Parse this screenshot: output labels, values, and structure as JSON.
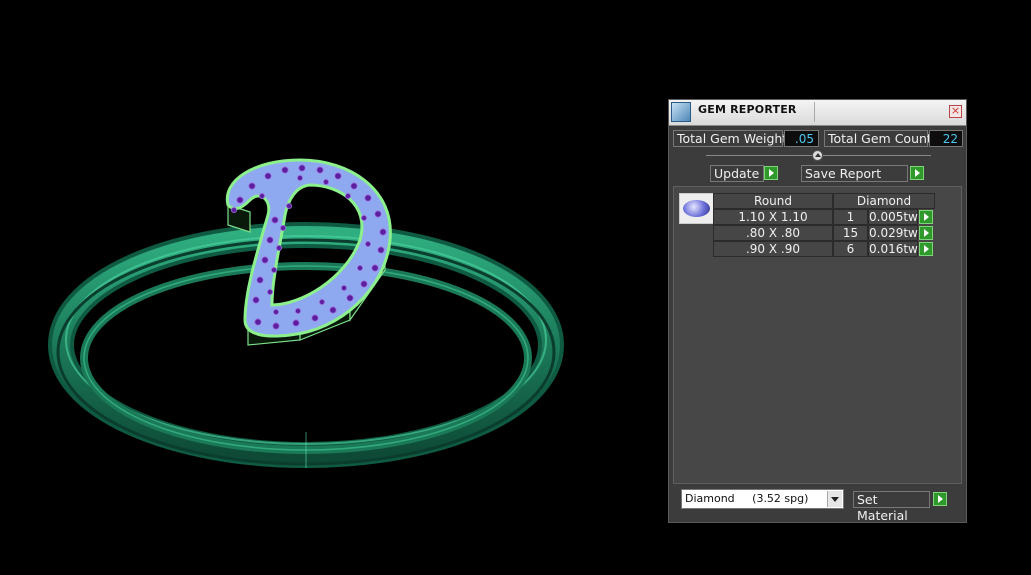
{
  "panel": {
    "title": "GEM REPORTER",
    "close_glyph": "×",
    "total_weight_label": "Total Gem Weight",
    "total_weight_value": ".05",
    "total_count_label": "Total Gem Count",
    "total_count_value": "22",
    "update_label": "Update",
    "save_report_label": "Save Report",
    "table": {
      "header_shape": "Round",
      "header_material": "Diamond",
      "rows": [
        {
          "size": "1.10 X 1.10",
          "count": "1",
          "weight": "0.005tw"
        },
        {
          "size": ".80 X .80",
          "count": "15",
          "weight": "0.029tw"
        },
        {
          "size": ".90 X .90",
          "count": "6",
          "weight": "0.016tw"
        }
      ]
    },
    "material_select": "Diamond     (3.52 spg)",
    "set_material_label": "Set Material"
  },
  "colors": {
    "accent_blue_value": "#4ec8f0",
    "go_green": "#2f9a2b",
    "ring_green": "#1c8a63",
    "stone_fill": "#8fa8f0",
    "gem_purple": "#5b1fa0"
  }
}
